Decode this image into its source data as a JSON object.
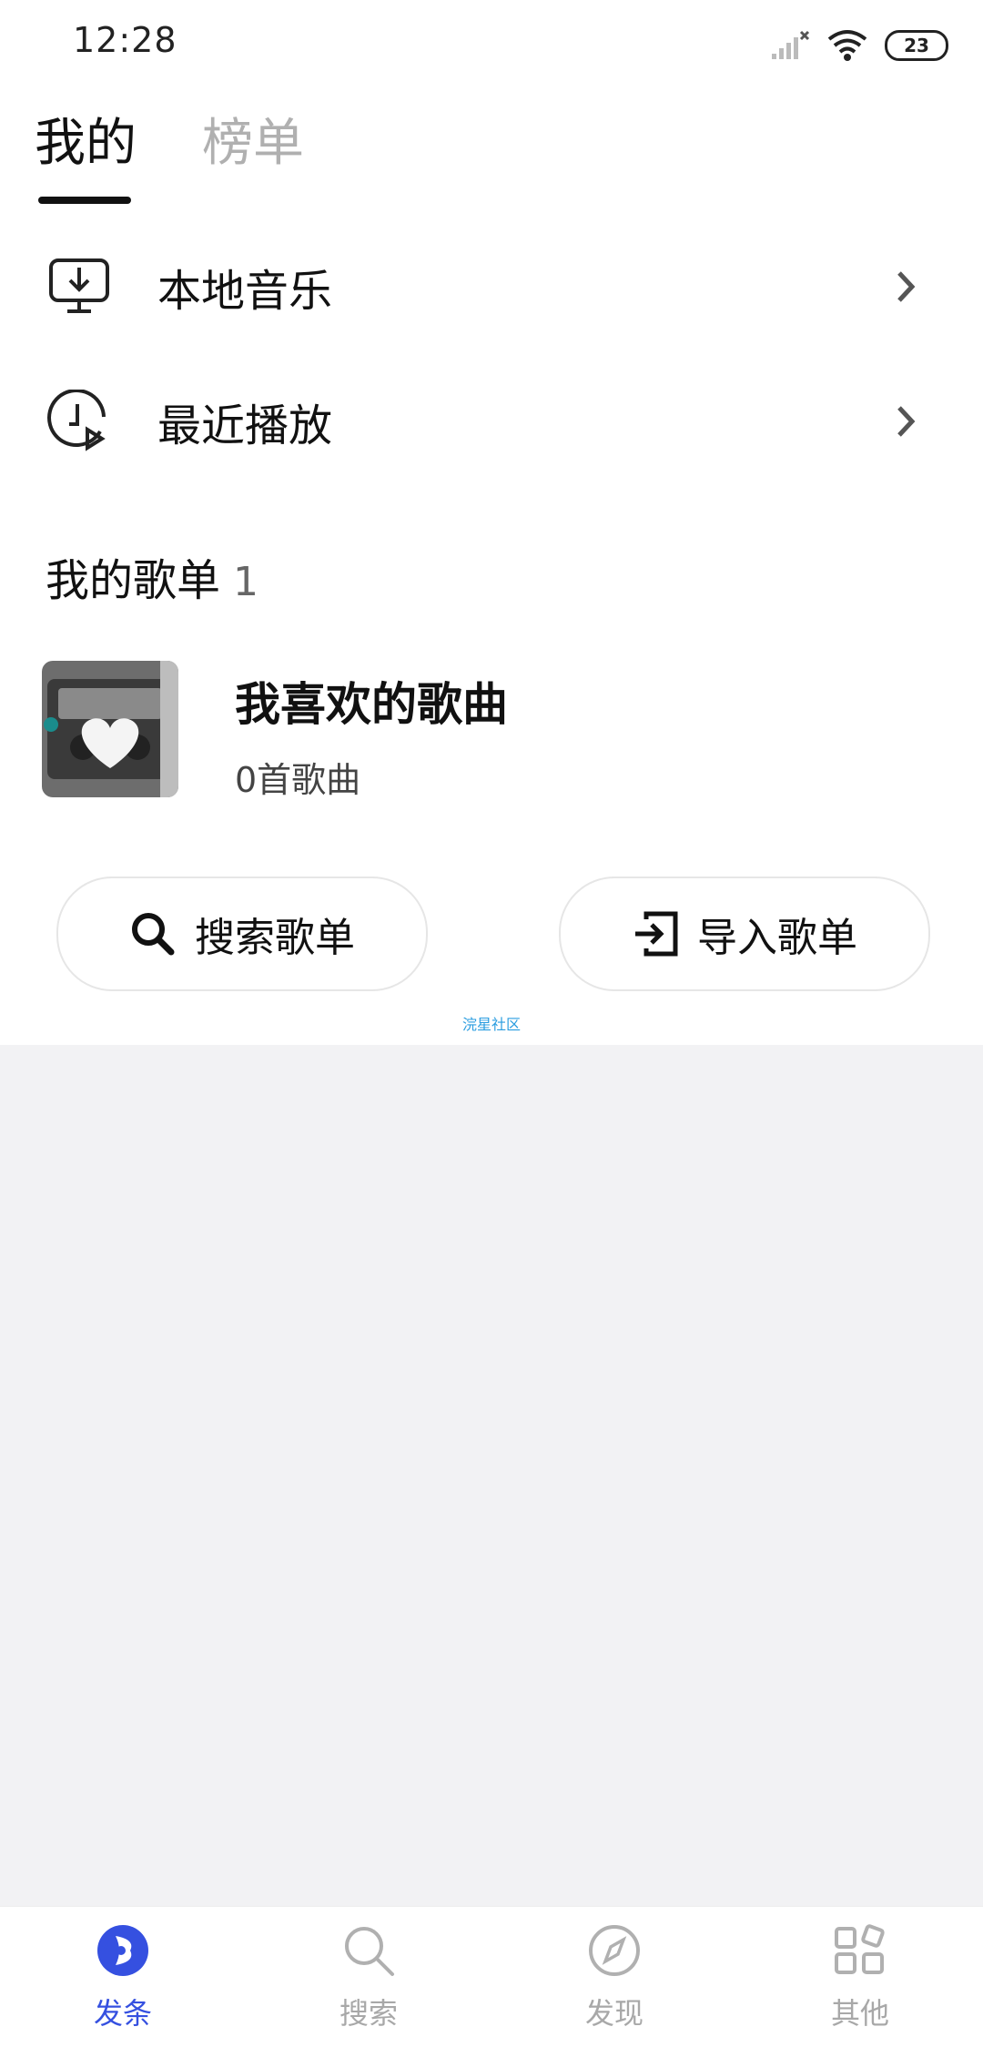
{
  "status_bar": {
    "time": "12:28",
    "battery": "23"
  },
  "tabs": [
    {
      "label": "我的"
    },
    {
      "label": "榜单"
    }
  ],
  "menu": [
    {
      "label": "本地音乐",
      "icon": "download-monitor-icon"
    },
    {
      "label": "最近播放",
      "icon": "clock-play-icon"
    }
  ],
  "my_playlists": {
    "title": "我的歌单",
    "count": "1",
    "items": [
      {
        "name": "我喜欢的歌曲",
        "song_count": "0首歌曲",
        "cover": "cassette-heart-cover"
      }
    ]
  },
  "actions": {
    "search_label": "搜索歌单",
    "import_label": "导入歌单"
  },
  "watermark": "浣星社区",
  "bottom_nav": [
    {
      "label": "发条",
      "icon": "app-logo-icon",
      "active": true
    },
    {
      "label": "搜索",
      "icon": "search-icon",
      "active": false
    },
    {
      "label": "发现",
      "icon": "compass-icon",
      "active": false
    },
    {
      "label": "其他",
      "icon": "grid-icon",
      "active": false
    }
  ],
  "colors": {
    "accent": "#3550e0",
    "inactive": "#a8a8a8",
    "background_gray": "#f2f2f4"
  }
}
